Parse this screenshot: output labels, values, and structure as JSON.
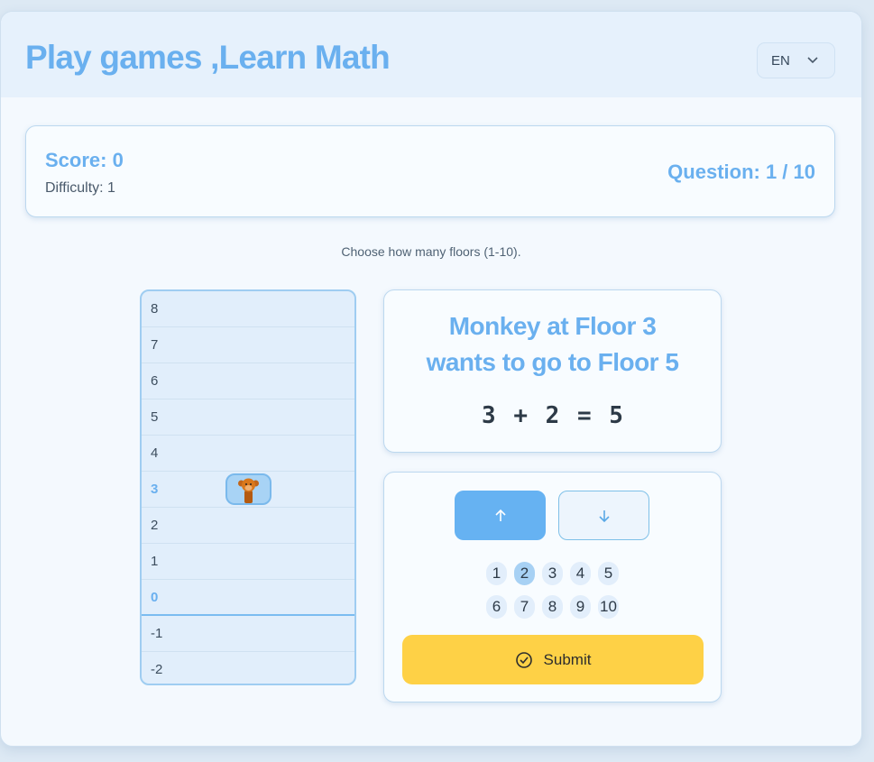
{
  "header": {
    "title": "Play games ,Learn Math",
    "language": "EN"
  },
  "status": {
    "score": "Score: 0",
    "difficulty": "Difficulty: 1",
    "question": "Question: 1 / 10"
  },
  "instruction": "Choose how many floors (1-10).",
  "building": {
    "floors": [
      "8",
      "7",
      "6",
      "5",
      "4",
      "3",
      "2",
      "1",
      "0",
      "-1",
      "-2"
    ],
    "monkey_floor": "3",
    "highlighted_floors": [
      "3",
      "0"
    ]
  },
  "problem": {
    "line1": "Monkey at Floor 3",
    "line2": "wants to go to Floor 5",
    "equation": "3 + 2 = 5"
  },
  "controls": {
    "direction_selected": "up",
    "numbers_row1": [
      "1",
      "2",
      "3",
      "4",
      "5"
    ],
    "numbers_row2": [
      "6",
      "7",
      "8",
      "9",
      "10"
    ],
    "selected_number": "2",
    "submit_label": "Submit"
  },
  "colors": {
    "accent": "#6ab0ef",
    "submit": "#fed146",
    "selected": "#a7d1f4"
  }
}
